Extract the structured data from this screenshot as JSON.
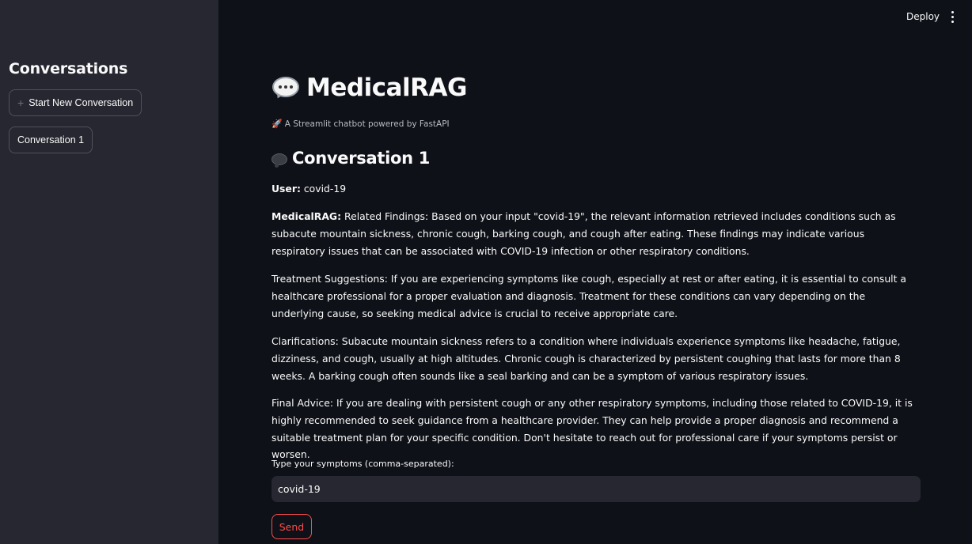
{
  "header": {
    "deploy_label": "Deploy"
  },
  "sidebar": {
    "title": "Conversations",
    "new_conversation_label": "Start New Conversation",
    "new_conversation_icon": "+",
    "conversations": [
      {
        "label": "Conversation 1"
      }
    ]
  },
  "main": {
    "title": "MedicalRAG",
    "title_icon": "speech-bubble-icon",
    "subtitle": "A Streamlit chatbot powered by FastAPI",
    "subtitle_icon": "🚀",
    "conversation_heading": "Conversation 1",
    "messages": {
      "user_prefix": "User:",
      "user_text": "covid-19",
      "bot_prefix": "MedicalRAG:",
      "bot_paragraphs": [
        "Related Findings: Based on your input \"covid-19\", the relevant information retrieved includes conditions such as subacute mountain sickness, chronic cough, barking cough, and cough after eating. These findings may indicate various respiratory issues that can be associated with COVID-19 infection or other respiratory conditions.",
        "Treatment Suggestions: If you are experiencing symptoms like cough, especially at rest or after eating, it is essential to consult a healthcare professional for a proper evaluation and diagnosis. Treatment for these conditions can vary depending on the underlying cause, so seeking medical advice is crucial to receive appropriate care.",
        "Clarifications: Subacute mountain sickness refers to a condition where individuals experience symptoms like headache, fatigue, dizziness, and cough, usually at high altitudes. Chronic cough is characterized by persistent coughing that lasts for more than 8 weeks. A barking cough often sounds like a seal barking and can be a symptom of various respiratory issues.",
        "Final Advice: If you are dealing with persistent cough or any other respiratory symptoms, including those related to COVID-19, it is highly recommended to seek guidance from a healthcare provider. They can help provide a proper diagnosis and recommend a suitable treatment plan for your specific condition. Don't hesitate to reach out for professional care if your symptoms persist or worsen."
      ]
    },
    "input": {
      "label": "Type your symptoms (comma-separated):",
      "value": "covid-19"
    },
    "send_label": "Send"
  },
  "colors": {
    "background": "#0e1117",
    "sidebar": "#262730",
    "accent": "#ff4b4b",
    "text": "#fafafa"
  }
}
